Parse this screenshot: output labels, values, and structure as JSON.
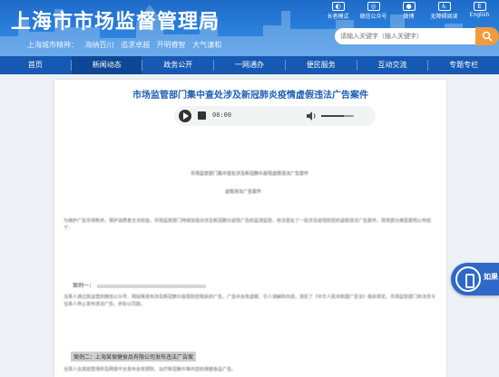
{
  "header": {
    "site_title": "上海市市场监督管理局",
    "slogans": [
      "上海城市精神：",
      "海纳百川",
      "追求卓越",
      "开明睿智",
      "大气谦和"
    ],
    "top_icons": [
      {
        "label": "长者模式",
        "icon": "elder-mode-icon"
      },
      {
        "label": "微信公众号",
        "icon": "wechat-icon"
      },
      {
        "label": "微博",
        "icon": "weibo-icon"
      },
      {
        "label": "无障碍阅读",
        "icon": "accessibility-icon"
      },
      {
        "label": "English",
        "icon": "english-icon"
      }
    ],
    "search_placeholder": "请输入关键字（输入关键字）"
  },
  "nav": {
    "items": [
      "首页",
      "新闻动态",
      "政务公开",
      "一网通办",
      "便民服务",
      "互动交流",
      "专题专栏"
    ],
    "active_index": 1
  },
  "article": {
    "title": "市场监管部门集中查处涉及新冠肺炎疫情虚假违法广告案件",
    "audio": {
      "time": "00:00"
    },
    "doc_title": "市场监管部门集中查处涉及新冠肺炎疫情虚假违法广告案件",
    "doc_subtitle": "虚假违法广告案件",
    "para1": "为维护广告市场秩序，保护消费者合法权益，市场监管部门持续加强对涉及新冠肺炎疫情广告的监测监管，依法查处了一批涉及疫情防控的虚假违法广告案件。现将部分典型案例公布如下：",
    "case_one_label": "案例一：",
    "para2": "当事人通过其运营的微信公众号、网站等发布涉及新冠肺炎疫情防控相关的广告，广告中含有虚假、引人误解的内容，违反了《中华人民共和国广告法》相关规定。市场监管部门依法责令当事人停止发布违法广告，并处以罚款。",
    "case_tag": "案例二：上海某保健食品有限公司发布违法广告案",
    "para3": "当事人在其经营场所及网络平台发布含有预防、治疗新冠肺炎等内容的保健食品广告。"
  },
  "float_widget": {
    "label": "如果"
  },
  "colors": {
    "header_blue": "#2a80dc",
    "nav_blue": "#1659b3",
    "title_blue": "#1f5fb3",
    "search_orange": "#f39a3c"
  }
}
